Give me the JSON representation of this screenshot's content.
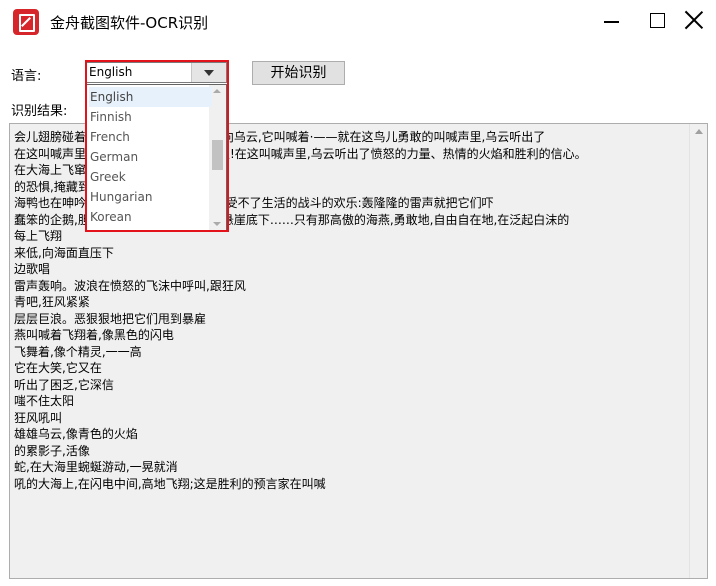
{
  "window": {
    "title": "金舟截图软件-OCR识别",
    "controls": {
      "minimize": "minimize",
      "maximize": "maximize",
      "close": "close"
    }
  },
  "form": {
    "language_label": "语言:",
    "language_selected": "English",
    "start_button": "开始识别",
    "result_label": "识别结果:"
  },
  "dropdown": {
    "options": [
      "English",
      "Finnish",
      "French",
      "German",
      "Greek",
      "Hungarian",
      "Korean"
    ],
    "highlighted": "English"
  },
  "result": {
    "lines": [
      "会儿翅膀碰着波浪,一会儿箭一般地直冲向乌云,它叫喊着·——就在这鸟儿勇敢的叫喊声里,乌云听出了",
      "在这叫喊声里——充满着对暴风雨的渴望!在这叫喊声里,乌云听出了愤怒的力量、热情的火焰和胜利的信心。",
      "在大海上飞窜,想把自己",
      "的恐惧,掩藏到大海深处。",
      "海鸭也在呻吟着,——它们这些海鸭啊,享受不了生活的战斗的欢乐:轰隆隆的雷声就把它们吓",
      "蠢笨的企鹅,胆怯地把肥胖的身体躲藏到悬崖底下……只有那高傲的海燕,勇敢地,自由自在地,在泛起白沫的",
      "每上飞翔",
      "来低,向海面直压下",
      "边歌唱",
      "雷声轰响。波浪在愤怒的飞沫中呼叫,跟狂风",
      "青吧,狂风紧紧",
      "层层巨浪。恶狠狠地把它们甩到暴雇",
      "燕叫喊着飞翔着,像黑色的闪电",
      "飞舞着,像个精灵,一一高",
      "它在大笑,它又在",
      "听出了困乏,它深信",
      "嗤不住太阳",
      "狂风吼叫",
      "雄雄乌云,像青色的火焰",
      "的累影子,活像",
      "蛇,在大海里蜿蜒游动,一晃就消",
      "吼的大海上,在闪电中间,高地飞翔;这是胜利的预言家在叫喊"
    ]
  },
  "colors": {
    "accent_highlight": "#e3121b",
    "app_icon": "#d7262b",
    "selected_option": "#e7f1fb"
  }
}
